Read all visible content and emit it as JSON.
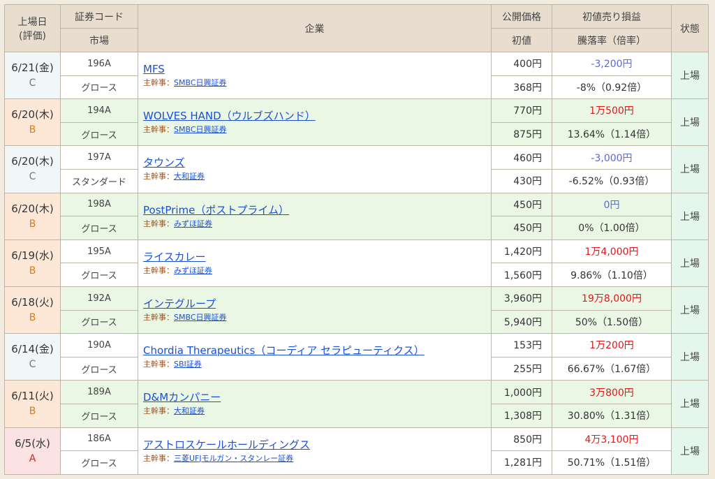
{
  "header": {
    "col_date_line1": "上場日",
    "col_date_line2": "(評価)",
    "col_code": "証券コード",
    "col_market": "市場",
    "col_company": "企業",
    "col_offer": "公開価格",
    "col_first": "初値",
    "col_profit": "初値売り損益",
    "col_rate": "騰落率（倍率）",
    "col_status": "状態"
  },
  "lead_label": "主幹事：",
  "rows": [
    {
      "date": "6/21(金)",
      "grade": "C",
      "code": "196A",
      "market": "グロース",
      "company": "MFS",
      "lead": "SMBC日興証券",
      "offer": "400円",
      "first": "368円",
      "profit": "-3,200円",
      "profit_sign": "neg",
      "rate": "-8%（0.92倍）",
      "status": "上場"
    },
    {
      "date": "6/20(木)",
      "grade": "B",
      "code": "194A",
      "market": "グロース",
      "company": "WOLVES HAND（ウルブズハンド）",
      "lead": "SMBC日興証券",
      "offer": "770円",
      "first": "875円",
      "profit": "1万500円",
      "profit_sign": "pos",
      "rate": "13.64%（1.14倍）",
      "status": "上場"
    },
    {
      "date": "6/20(木)",
      "grade": "C",
      "code": "197A",
      "market": "スタンダード",
      "company": "タウンズ",
      "lead": "大和証券",
      "offer": "460円",
      "first": "430円",
      "profit": "-3,000円",
      "profit_sign": "neg",
      "rate": "-6.52%（0.93倍）",
      "status": "上場"
    },
    {
      "date": "6/20(木)",
      "grade": "B",
      "code": "198A",
      "market": "グロース",
      "company": "PostPrime（ポストプライム）",
      "lead": "みずほ証券",
      "offer": "450円",
      "first": "450円",
      "profit": "0円",
      "profit_sign": "neg",
      "rate": "0%（1.00倍）",
      "status": "上場"
    },
    {
      "date": "6/19(水)",
      "grade": "B",
      "code": "195A",
      "market": "グロース",
      "company": "ライスカレー",
      "lead": "みずほ証券",
      "offer": "1,420円",
      "first": "1,560円",
      "profit": "1万4,000円",
      "profit_sign": "pos",
      "rate": "9.86%（1.10倍）",
      "status": "上場"
    },
    {
      "date": "6/18(火)",
      "grade": "B",
      "code": "192A",
      "market": "グロース",
      "company": "インテグループ",
      "lead": "SMBC日興証券",
      "offer": "3,960円",
      "first": "5,940円",
      "profit": "19万8,000円",
      "profit_sign": "pos",
      "rate": "50%（1.50倍）",
      "status": "上場"
    },
    {
      "date": "6/14(金)",
      "grade": "C",
      "code": "190A",
      "market": "グロース",
      "company": "Chordia Therapeutics（コーディア セラピューティクス）",
      "lead": "SBI証券",
      "offer": "153円",
      "first": "255円",
      "profit": "1万200円",
      "profit_sign": "pos",
      "rate": "66.67%（1.67倍）",
      "status": "上場"
    },
    {
      "date": "6/11(火)",
      "grade": "B",
      "code": "189A",
      "market": "グロース",
      "company": "D&Mカンパニー",
      "lead": "大和証券",
      "offer": "1,000円",
      "first": "1,308円",
      "profit": "3万800円",
      "profit_sign": "pos",
      "rate": "30.80%（1.31倍）",
      "status": "上場"
    },
    {
      "date": "6/5(水)",
      "grade": "A",
      "code": "186A",
      "market": "グロース",
      "company": "アストロスケールホールディングス",
      "lead": "三菱UFJモルガン・スタンレー証券",
      "offer": "850円",
      "first": "1,281円",
      "profit": "4万3,100円",
      "profit_sign": "pos",
      "rate": "50.71%（1.51倍）",
      "status": "上場"
    }
  ],
  "colors": {
    "grade_A": "#e02020",
    "grade_B": "#e07a14",
    "grade_C": "#6a7a86",
    "profit_pos": "#e01818",
    "profit_neg": "#5a6ad6",
    "link": "#1a4fd6"
  }
}
